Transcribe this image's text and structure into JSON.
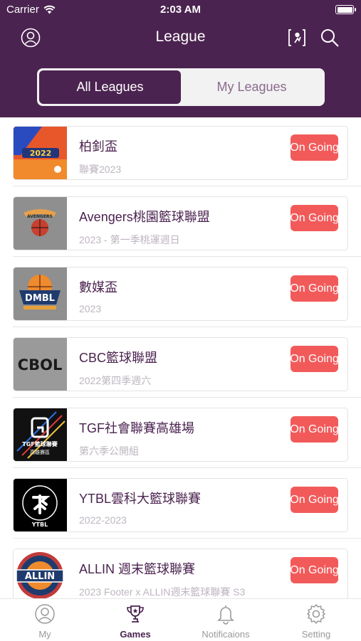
{
  "status_bar": {
    "carrier": "Carrier",
    "time": "2:03 AM"
  },
  "nav": {
    "title": "League",
    "icons": [
      "profile-icon",
      "basketball-card-icon",
      "search-icon"
    ]
  },
  "segment": {
    "all_label": "All Leagues",
    "my_label": "My Leagues",
    "selected": "All Leagues"
  },
  "colors": {
    "brand": "#4b2350",
    "badge": "#f25a5a",
    "subtitle": "#bdb5bf"
  },
  "leagues": [
    {
      "name": "柏釗盃",
      "season": "聯賽2023",
      "status": "On Going",
      "logo_text": "2022",
      "logo_bg": "#e8572a"
    },
    {
      "name": "Avengers桃園籃球聯盟",
      "season": "2023 - 第一季桃運週日",
      "status": "On Going",
      "logo_text": "AVENGERS",
      "logo_bg": "#8f8f8f"
    },
    {
      "name": "數媒盃",
      "season": "2023",
      "status": "On Going",
      "logo_text": "DMBL",
      "logo_bg": "#8f8f8f"
    },
    {
      "name": "CBC籃球聯盟",
      "season": "2022第四季週六",
      "status": "On Going",
      "logo_text": "CBOL",
      "logo_bg": "#9a9a9a"
    },
    {
      "name": "TGF社會聯賽高雄場",
      "season": "第六季公開組",
      "status": "On Going",
      "logo_text": "TGF籃球聯賽",
      "logo_sub": "高雄賽區",
      "logo_bg": "#111111"
    },
    {
      "name": "YTBL雲科大籃球聯賽",
      "season": "2022-2023",
      "status": "On Going",
      "logo_text": "YTBL",
      "logo_bg": "#000000"
    },
    {
      "name": "ALLIN 週末籃球聯賽",
      "season": "2023 Footer x ALLIN週末籃球聯賽 S3",
      "status": "On Going",
      "logo_text": "ALLIN",
      "logo_bg": "#ffffff"
    }
  ],
  "tabbar": {
    "tabs": [
      {
        "label": "My",
        "icon": "person-icon"
      },
      {
        "label": "Games",
        "icon": "trophy-icon"
      },
      {
        "label": "Notificaions",
        "icon": "bell-icon"
      },
      {
        "label": "Setting",
        "icon": "gear-icon"
      }
    ],
    "active": "Games"
  }
}
